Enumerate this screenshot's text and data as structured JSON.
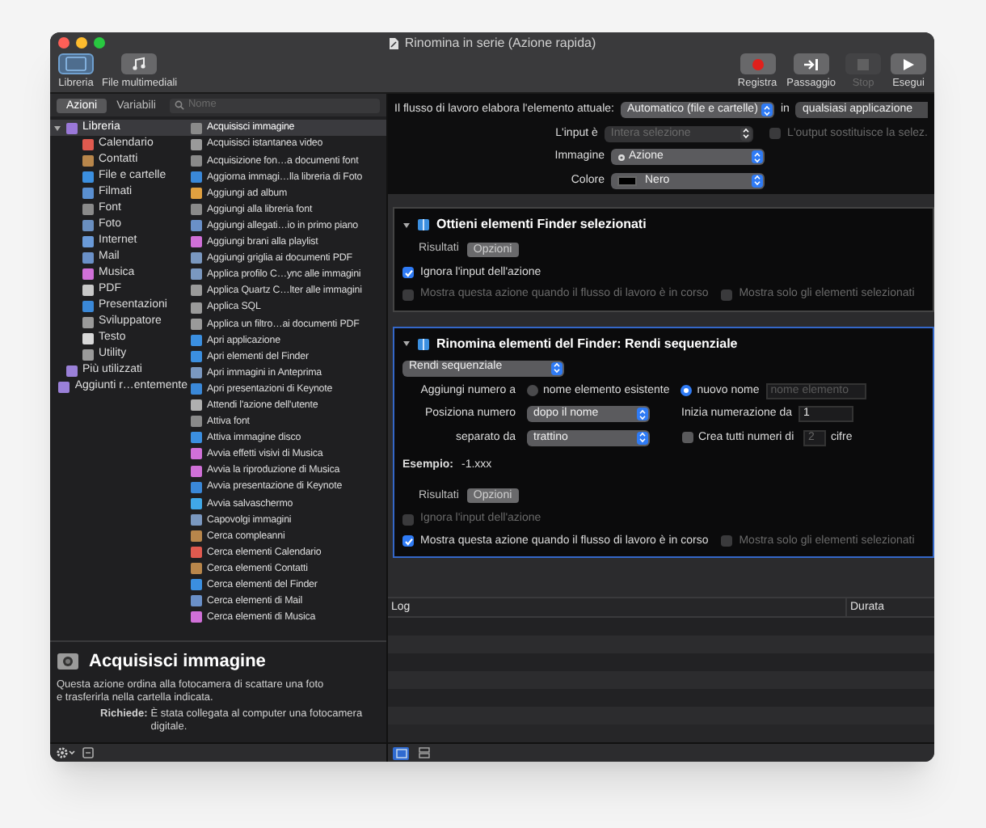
{
  "window": {
    "title": "Rinomina in serie (Azione rapida)"
  },
  "toolbar": {
    "left": [
      {
        "label": "Libreria",
        "kind": "library",
        "selected": true
      },
      {
        "label": "File multimediali",
        "kind": "media",
        "selected": false
      }
    ],
    "right": [
      {
        "label": "Registra",
        "kind": "record",
        "disabled": false
      },
      {
        "label": "Passaggio",
        "kind": "step",
        "disabled": false
      },
      {
        "label": "Stop",
        "kind": "stop",
        "disabled": true
      },
      {
        "label": "Esegui",
        "kind": "run",
        "disabled": false
      }
    ]
  },
  "library": {
    "tabs": [
      {
        "label": "Azioni",
        "selected": true
      },
      {
        "label": "Variabili",
        "selected": false
      }
    ],
    "search": {
      "placeholder": "Nome"
    },
    "categories": [
      {
        "label": "Libreria",
        "color": "#9a78d8",
        "selected": true,
        "expanded": true,
        "children": [
          {
            "label": "Calendario",
            "color": "#e05a4f",
            "selected": false
          },
          {
            "label": "Contatti",
            "color": "#b8864b",
            "selected": false
          },
          {
            "label": "File e cartelle",
            "color": "#3b8fe0",
            "selected": false
          },
          {
            "label": "Filmati",
            "color": "#5a8fd0",
            "selected": false
          },
          {
            "label": "Font",
            "color": "#8a8a8a",
            "selected": false
          },
          {
            "label": "Foto",
            "color": "#6a8fc0",
            "selected": false
          },
          {
            "label": "Internet",
            "color": "#6a9ad8",
            "selected": false
          },
          {
            "label": "Mail",
            "color": "#6a90c8",
            "selected": false
          },
          {
            "label": "Musica",
            "color": "#d070d8",
            "selected": false
          },
          {
            "label": "PDF",
            "color": "#c8c8c8",
            "selected": false
          },
          {
            "label": "Presentazioni",
            "color": "#3a88d8",
            "selected": false
          },
          {
            "label": "Sviluppatore",
            "color": "#9a9a9a",
            "selected": false
          },
          {
            "label": "Testo",
            "color": "#d8d8d8",
            "selected": false
          },
          {
            "label": "Utility",
            "color": "#9a9a9a",
            "selected": false
          }
        ]
      },
      {
        "label": "Più utilizzati",
        "color": "#9a80d8",
        "selected": false
      },
      {
        "label": "Aggiunti r…entemente",
        "color": "#9a80d8",
        "selected": false
      }
    ],
    "actions": [
      {
        "label": "Acquisisci immagine",
        "color": "#8a8a8a",
        "selected": true
      },
      {
        "label": "Acquisisci istantanea video",
        "color": "#9a9a9a",
        "selected": false
      },
      {
        "label": "Acquisizione fon…a documenti font",
        "color": "#8a8a8a",
        "selected": false
      },
      {
        "label": "Aggiorna immagi…lla libreria di Foto",
        "color": "#3a88d8",
        "selected": false
      },
      {
        "label": "Aggiungi ad album",
        "color": "#e0a040",
        "selected": false
      },
      {
        "label": "Aggiungi alla libreria font",
        "color": "#8a8a8a",
        "selected": false
      },
      {
        "label": "Aggiungi allegati…io in primo piano",
        "color": "#6a90c8",
        "selected": false
      },
      {
        "label": "Aggiungi brani alla playlist",
        "color": "#d070d8",
        "selected": false
      },
      {
        "label": "Aggiungi griglia ai documenti PDF",
        "color": "#7a98c0",
        "selected": false
      },
      {
        "label": "Applica profilo C…ync alle immagini",
        "color": "#7a98c0",
        "selected": false
      },
      {
        "label": "Applica Quartz C…lter alle immagini",
        "color": "#9a9a9a",
        "selected": false
      },
      {
        "label": "Applica SQL",
        "color": "#9a9a9a",
        "selected": false
      },
      {
        "label": "Applica un filtro…ai documenti PDF",
        "color": "#9a9a9a",
        "selected": false
      },
      {
        "label": "Apri applicazione",
        "color": "#3b8fe0",
        "selected": false
      },
      {
        "label": "Apri elementi del Finder",
        "color": "#3b8fe0",
        "selected": false
      },
      {
        "label": "Apri immagini in Anteprima",
        "color": "#7a98c0",
        "selected": false
      },
      {
        "label": "Apri presentazioni di Keynote",
        "color": "#3a88d8",
        "selected": false
      },
      {
        "label": "Attendi l'azione dell'utente",
        "color": "#b0b0b0",
        "selected": false
      },
      {
        "label": "Attiva font",
        "color": "#8a8a8a",
        "selected": false
      },
      {
        "label": "Attiva immagine disco",
        "color": "#3b8fe0",
        "selected": false
      },
      {
        "label": "Avvia effetti visivi di Musica",
        "color": "#d070d8",
        "selected": false
      },
      {
        "label": "Avvia la riproduzione di Musica",
        "color": "#d070d8",
        "selected": false
      },
      {
        "label": "Avvia presentazione di Keynote",
        "color": "#3a88d8",
        "selected": false
      },
      {
        "label": "Avvia salvaschermo",
        "color": "#40a8e8",
        "selected": false
      },
      {
        "label": "Capovolgi immagini",
        "color": "#7a98c0",
        "selected": false
      },
      {
        "label": "Cerca compleanni",
        "color": "#b8864b",
        "selected": false
      },
      {
        "label": "Cerca elementi Calendario",
        "color": "#e05a4f",
        "selected": false
      },
      {
        "label": "Cerca elementi Contatti",
        "color": "#b8864b",
        "selected": false
      },
      {
        "label": "Cerca elementi del Finder",
        "color": "#3b8fe0",
        "selected": false
      },
      {
        "label": "Cerca elementi di Mail",
        "color": "#6a90c8",
        "selected": false
      },
      {
        "label": "Cerca elementi di Musica",
        "color": "#d070d8",
        "selected": false
      }
    ],
    "description": {
      "title": "Acquisisci immagine",
      "text": "Questa azione ordina alla fotocamera di scattare una foto e trasferirla nella cartella indicata.",
      "requires_label": "Richiede:",
      "requires": "È stata collegata al computer una fotocamera digitale."
    }
  },
  "workflow": {
    "settings": {
      "receives_label": "Il flusso di lavoro elabora l'elemento attuale:",
      "receives": "Automatico (file e cartelle)",
      "in_label": "in",
      "app": "qualsiasi applicazione",
      "input_label": "L'input è",
      "input": "Intera selezione",
      "input_disabled": true,
      "replace": {
        "label": "L'output sostituisce la selez.",
        "checked": false,
        "disabled": true
      },
      "image_label": "Immagine",
      "image": "Azione",
      "color_label": "Colore",
      "color_value": "Nero",
      "color": "#000000"
    },
    "actions": [
      {
        "kind": "get_selected",
        "title": "Ottieni elementi Finder selezionati",
        "selected": false,
        "results_label": "Risultati",
        "options_button": "Opzioni",
        "checkboxes": [
          {
            "label": "Ignora l'input dell'azione",
            "checked": true,
            "disabled": false
          },
          {
            "label": "Mostra questa azione quando il flusso di lavoro è in corso",
            "checked": false,
            "disabled": true
          },
          {
            "label": "Mostra solo gli elementi selezionati",
            "checked": false,
            "disabled": true
          }
        ]
      },
      {
        "kind": "rename",
        "title": "Rinomina elementi del Finder: Rendi sequenziale",
        "selected": true,
        "mode": "Rendi sequenziale",
        "add_label": "Aggiungi numero a",
        "targets": [
          {
            "label": "nome elemento esistente",
            "selected": false
          },
          {
            "label": "nuovo nome",
            "selected": true
          }
        ],
        "name_field": {
          "placeholder": "nome elemento"
        },
        "position_label": "Posiziona numero",
        "position": "dopo il nome",
        "start_label": "Inizia numerazione da",
        "start": "1",
        "separator_label": "separato da",
        "separator": "trattino",
        "digits": {
          "label": "Crea tutti numeri di",
          "checked": false,
          "value": "2",
          "unit": "cifre"
        },
        "example_label": "Esempio:",
        "example": "-1.xxx",
        "results_label": "Risultati",
        "options_button": "Opzioni",
        "checkboxes": [
          {
            "label": "Ignora l'input dell'azione",
            "checked": false,
            "disabled": true
          },
          {
            "label": "Mostra questa azione quando il flusso di lavoro è in corso",
            "checked": true,
            "disabled": false
          },
          {
            "label": "Mostra solo gli elementi selezionati",
            "checked": false,
            "disabled": true
          }
        ]
      }
    ]
  },
  "log": {
    "columns": [
      "Log",
      "Durata"
    ]
  },
  "bottom_bar": {
    "views": [
      {
        "selected": true
      },
      {
        "selected": false
      }
    ]
  }
}
